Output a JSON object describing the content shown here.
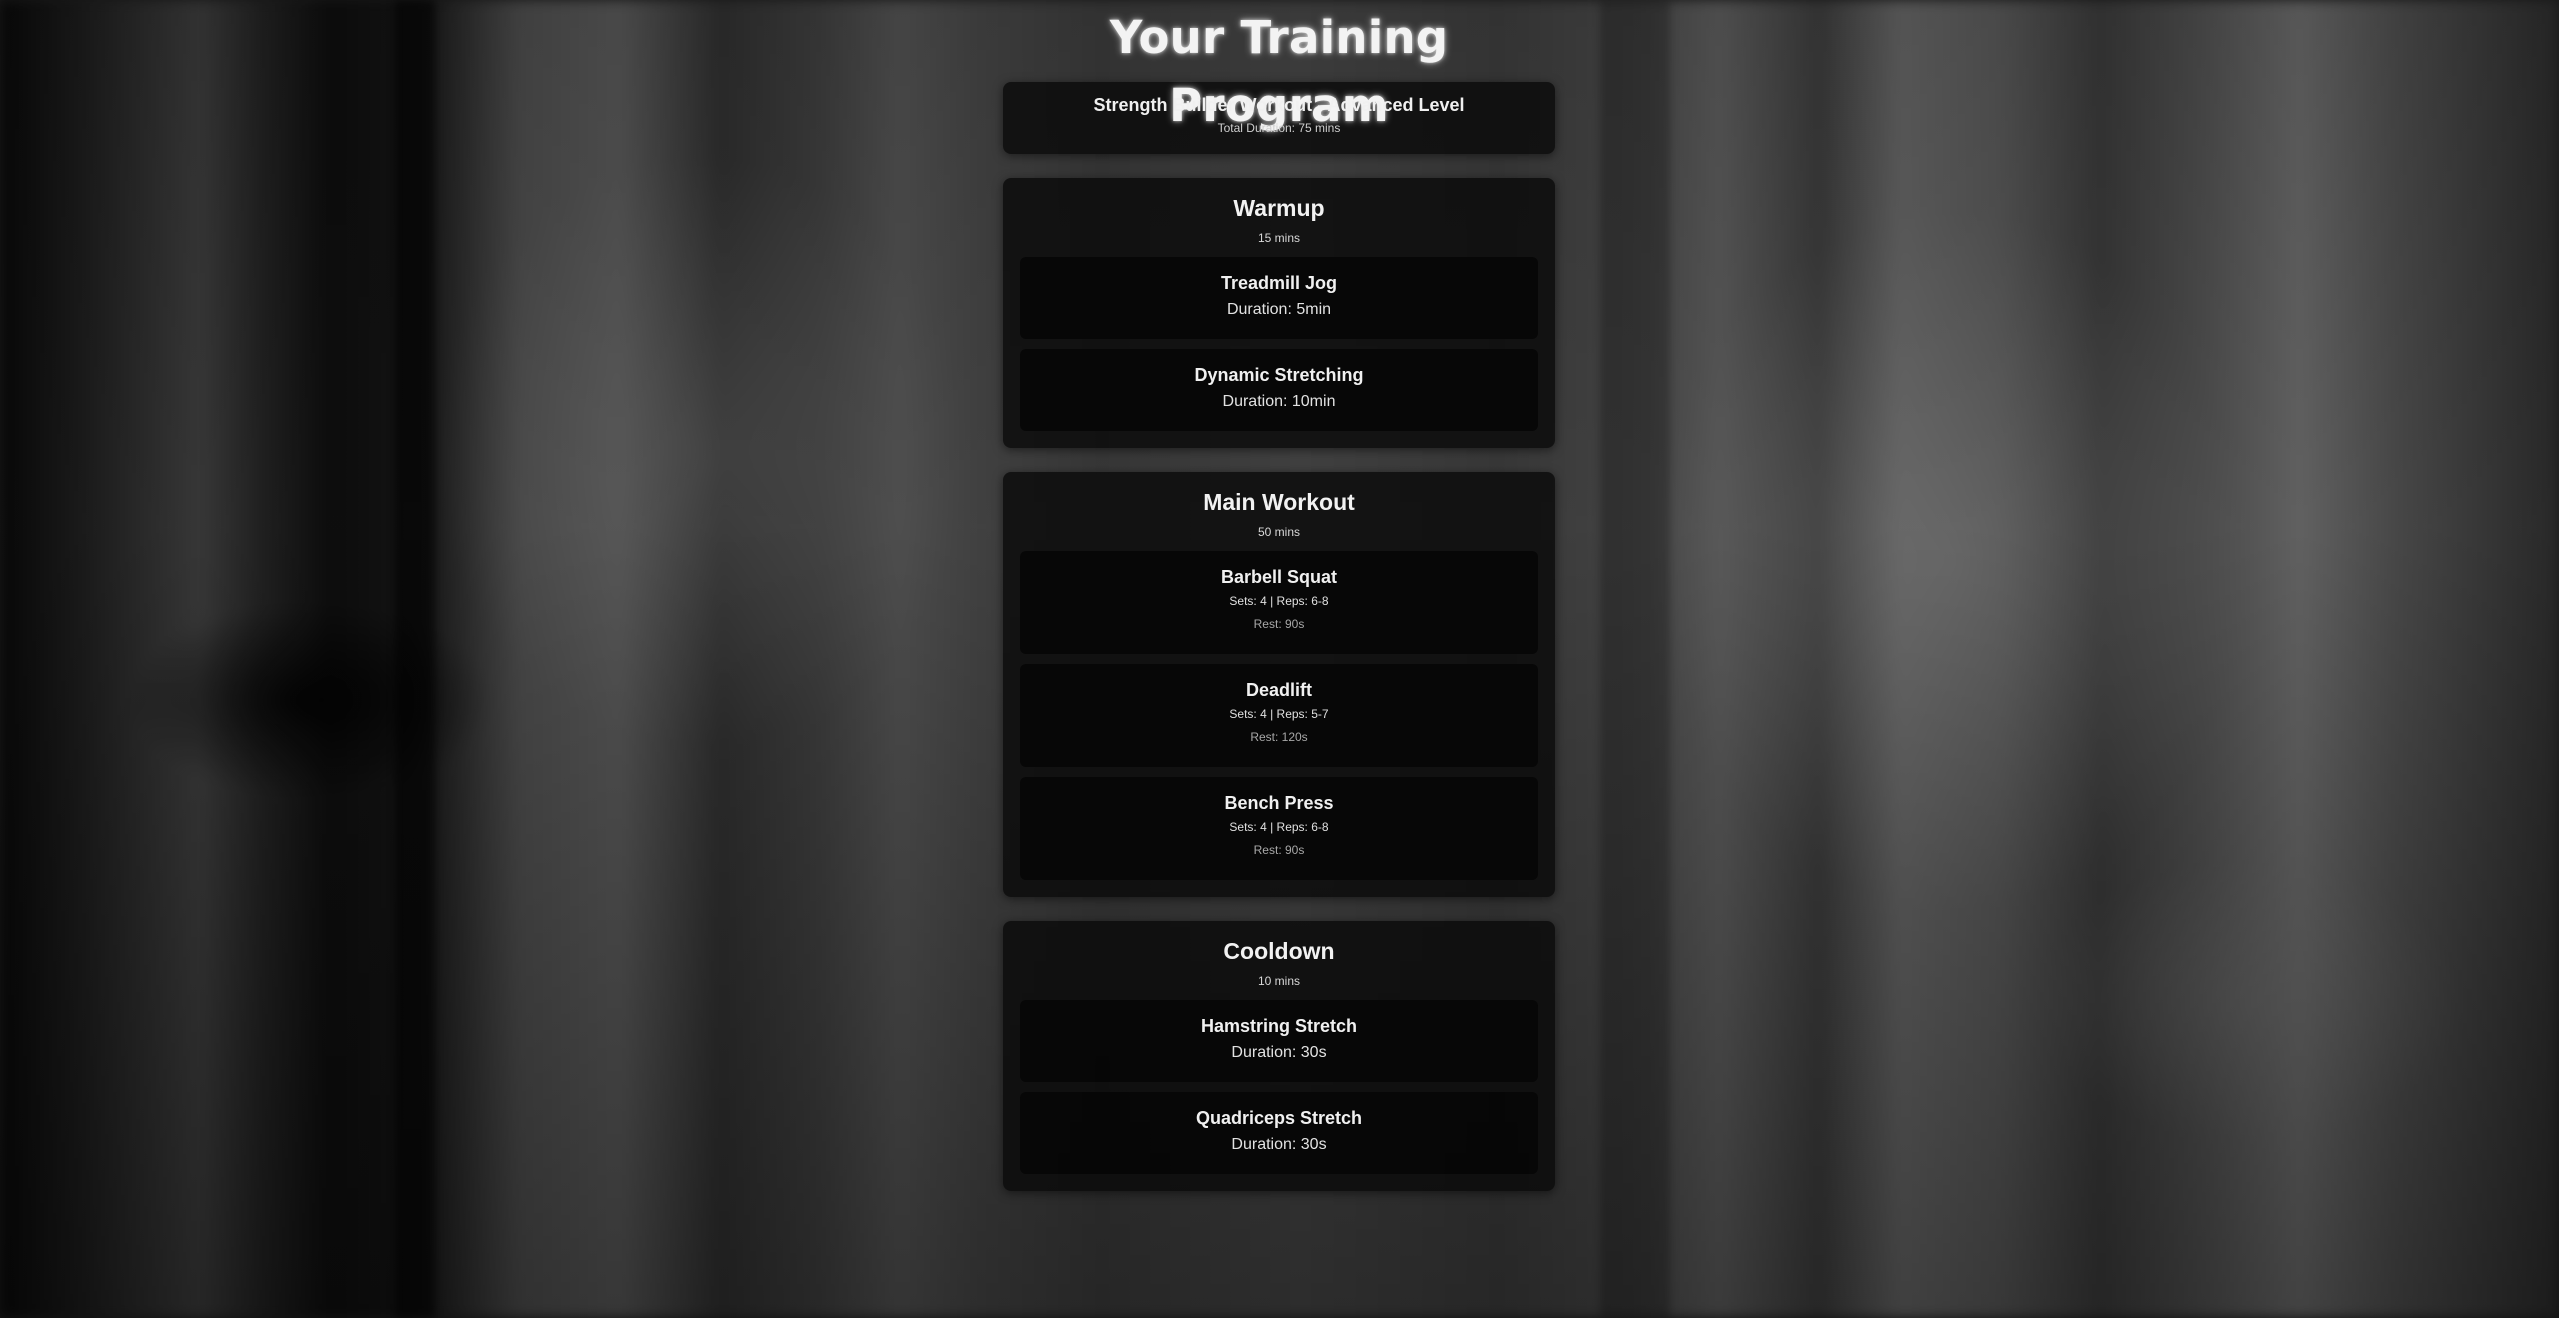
{
  "page": {
    "title": "Your Training Program"
  },
  "program": {
    "name": "Strength Builder Workout - Advanced Level",
    "total_duration": "Total Duration: 75 mins"
  },
  "sections": [
    {
      "title": "Warmup",
      "duration": "15 mins",
      "exercises": [
        {
          "name": "Treadmill Jog",
          "duration": "Duration: 5min"
        },
        {
          "name": "Dynamic Stretching",
          "duration": "Duration: 10min"
        }
      ]
    },
    {
      "title": "Main Workout",
      "duration": "50 mins",
      "exercises": [
        {
          "name": "Barbell Squat",
          "sets_reps": "Sets: 4 | Reps: 6-8",
          "rest": "Rest: 90s"
        },
        {
          "name": "Deadlift",
          "sets_reps": "Sets: 4 | Reps: 5-7",
          "rest": "Rest: 120s"
        },
        {
          "name": "Bench Press",
          "sets_reps": "Sets: 4 | Reps: 6-8",
          "rest": "Rest: 90s"
        }
      ]
    },
    {
      "title": "Cooldown",
      "duration": "10 mins",
      "exercises": [
        {
          "name": "Hamstring Stretch",
          "duration": "Duration: 30s"
        },
        {
          "name": "Quadriceps Stretch",
          "duration": "Duration: 30s"
        }
      ]
    }
  ],
  "theme": {
    "card_background": "#0a0a0a",
    "exercise_background": "#040404",
    "text_primary": "#f0f0f0",
    "text_muted": "#a8a8a8"
  }
}
